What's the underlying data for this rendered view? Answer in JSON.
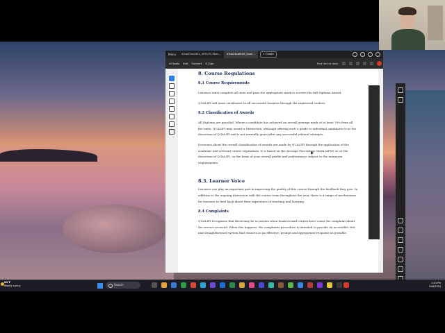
{
  "tabs": {
    "menu_label": "Menu",
    "items": [
      {
        "label": "d3da25a1d45c_4FE0-PC-Main..."
      },
      {
        "label": "d3da24ad8d0f_Quali..."
      }
    ],
    "create_label": "+ Create"
  },
  "toolbar": {
    "all_tools": "All tools",
    "edit": "Edit",
    "convert": "Convert",
    "esign": "E-Sign",
    "find": "Find text or tools"
  },
  "document": {
    "sections": [
      {
        "type": "h1",
        "text": "8. Course Regulations"
      },
      {
        "type": "h2",
        "text": "8.1 Course Requirements"
      },
      {
        "type": "p",
        "text": "Learners must complete all units and pass the appropriate mark to receive the full Diploma Award."
      },
      {
        "type": "p",
        "text": "QUALIFI will issue certificates to all successful learners through the registered centres."
      },
      {
        "type": "h2",
        "text": "8.2 Classification of Awards"
      },
      {
        "type": "p",
        "text": "All Diploma are pass/fail. Where a candidate has achieved an overall average mark of at least 70% from all the units, QUALIFI may award a Distinction, although offering such a grade to individual candidates is at the discretion of QUALIFI and is not normally given after any successful referral attempts."
      },
      {
        "type": "p",
        "text": "Decisions about the overall classification of awards are made by QUALIFI through the application of the academic and relevant course regulations. It is based on the Average Percentage Mark (APM) or, at the discretion of QUALIFI, on the basis of your overall profile and performance subject to the minimum requirements."
      },
      {
        "type": "h1",
        "text": "8.3. Learner Voice"
      },
      {
        "type": "p",
        "text": "Learners can play an important part in improving the quality of this course through the feedback they give. In addition to the ongoing discussion with the course team throughout the year, there is a range of mechanisms for learners to feed back about their experience of teaching and learning."
      },
      {
        "type": "h2",
        "text": "8.4 Complaints"
      },
      {
        "type": "p",
        "text": "QUALIFI recognises that there may be occasions when learners and centres have cause for complaint about the service received. When this happens, the complaints procedure is intended to provide an accessible, fair and straightforward system that ensures as an effective, prompt and appropriate response as possible."
      }
    ]
  },
  "taskbar": {
    "weather_temp": "84°F",
    "weather_desc": "Mostly sunny",
    "search_label": "Search",
    "time": "2:03 PM",
    "date": "10/8/2024"
  },
  "colors": {
    "heading": "#1a2a5a",
    "accent": "#2b7de9",
    "acrobat_red": "#d6392b"
  }
}
